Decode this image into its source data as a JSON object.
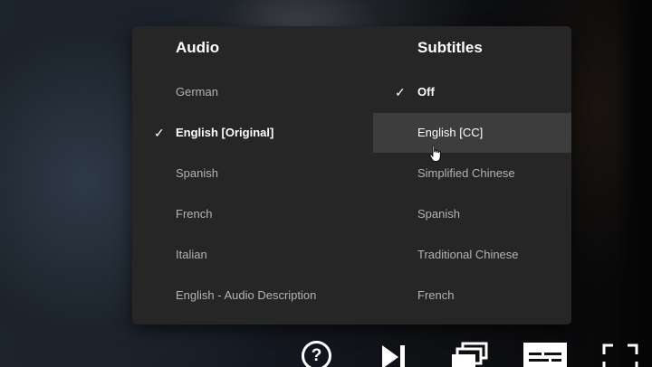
{
  "audio": {
    "heading": "Audio",
    "selected_mark": "✓",
    "options": [
      {
        "label": "German",
        "selected": false
      },
      {
        "label": "English [Original]",
        "selected": true
      },
      {
        "label": "Spanish",
        "selected": false
      },
      {
        "label": "French",
        "selected": false
      },
      {
        "label": "Italian",
        "selected": false
      },
      {
        "label": "English - Audio Description",
        "selected": false
      }
    ]
  },
  "subtitles": {
    "heading": "Subtitles",
    "selected_mark": "✓",
    "options": [
      {
        "label": "Off",
        "selected": true
      },
      {
        "label": "English [CC]",
        "selected": false,
        "hovered": true
      },
      {
        "label": "Simplified Chinese",
        "selected": false
      },
      {
        "label": "Spanish",
        "selected": false
      },
      {
        "label": "Traditional Chinese",
        "selected": false
      },
      {
        "label": "French",
        "selected": false
      }
    ]
  },
  "controls": {
    "help_glyph": "?",
    "icons": [
      "help-icon",
      "next-episode-icon",
      "episodes-icon",
      "subtitles-audio-icon",
      "fullscreen-icon"
    ]
  },
  "colors": {
    "menu_bg": "#262626",
    "hover_bg": "#3d3d3d",
    "text_active": "#ffffff",
    "text_inactive": "#b3b3b3"
  }
}
